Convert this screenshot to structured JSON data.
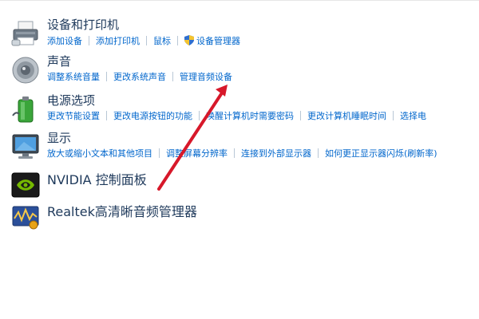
{
  "categories": {
    "devices": {
      "title": "设备和打印机",
      "links": [
        "添加设备",
        "添加打印机",
        "鼠标",
        "设备管理器"
      ],
      "icon": "printer-icon"
    },
    "sound": {
      "title": "声音",
      "links": [
        "调整系统音量",
        "更改系统声音",
        "管理音频设备"
      ],
      "icon": "speaker-icon"
    },
    "power": {
      "title": "电源选项",
      "links": [
        "更改节能设置",
        "更改电源按钮的功能",
        "唤醒计算机时需要密码",
        "更改计算机睡眠时间",
        "选择电"
      ],
      "icon": "battery-icon"
    },
    "display": {
      "title": "显示",
      "links": [
        "放大或缩小文本和其他项目",
        "调整屏幕分辨率",
        "连接到外部显示器",
        "如何更正显示器闪烁(刷新率)"
      ],
      "icon": "monitor-icon"
    },
    "nvidia": {
      "title": "NVIDIA 控制面板",
      "icon": "nvidia-logo-icon"
    },
    "realtek": {
      "title": "Realtek高清晰音频管理器",
      "icon": "realtek-audio-icon"
    }
  },
  "annotation": {
    "color": "#d7182a",
    "icon": "red-arrow-annotation"
  },
  "colors": {
    "title": "#1e395b",
    "link": "#0066cc"
  }
}
